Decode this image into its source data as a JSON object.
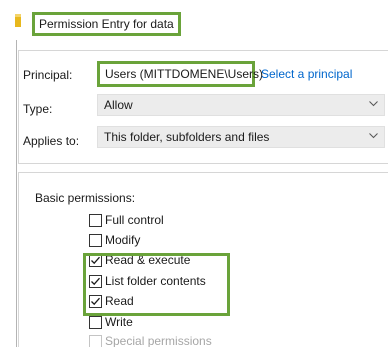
{
  "title": "Permission Entry for data",
  "principal": {
    "label": "Principal:",
    "value": "Users (MITTDOMENE\\Users)",
    "link": "Select a principal"
  },
  "type": {
    "label": "Type:",
    "selected": "Allow"
  },
  "applies_to": {
    "label": "Applies to:",
    "selected": "This folder, subfolders and files"
  },
  "basic_permissions": {
    "label": "Basic permissions:",
    "items": [
      {
        "label": "Full control",
        "checked": false,
        "disabled": false
      },
      {
        "label": "Modify",
        "checked": false,
        "disabled": false
      },
      {
        "label": "Read & execute",
        "checked": true,
        "disabled": false
      },
      {
        "label": "List folder contents",
        "checked": true,
        "disabled": false
      },
      {
        "label": "Read",
        "checked": true,
        "disabled": false
      },
      {
        "label": "Write",
        "checked": false,
        "disabled": false
      },
      {
        "label": "Special permissions",
        "checked": false,
        "disabled": true
      }
    ]
  },
  "colors": {
    "highlight": "#6aa33a",
    "link": "#0066cc",
    "folder": "#e8b81d"
  },
  "icons": {
    "folder": "folder-icon",
    "chevron": "chevron-down-icon",
    "check": "checkmark-icon"
  }
}
